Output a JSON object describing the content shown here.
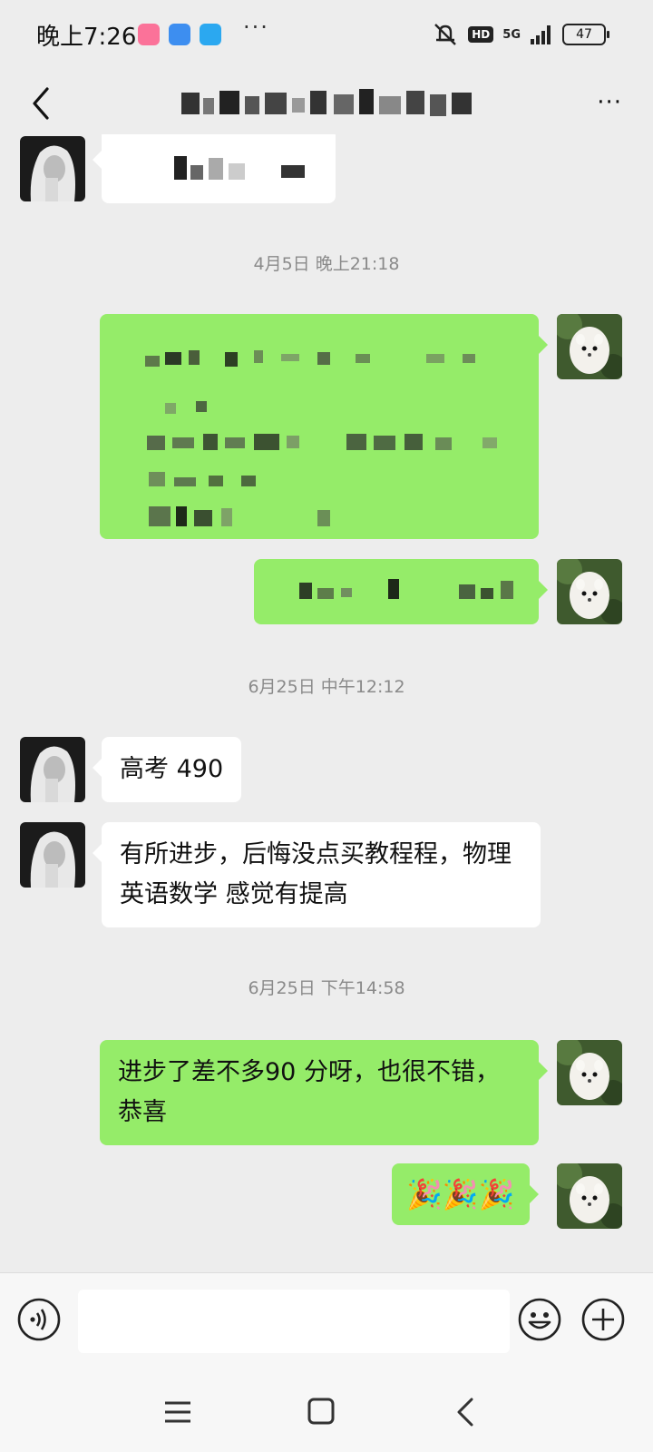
{
  "status_bar": {
    "time": "晚上7:26",
    "app_icons": [
      "bilibili-icon",
      "browser-icon",
      "app-icon"
    ],
    "more": "···",
    "hd": "HD",
    "network": "5G",
    "battery": "47"
  },
  "header": {
    "back_icon": "chevron-left-icon",
    "title_redacted": true,
    "more": "···"
  },
  "messages": [
    {
      "type": "message",
      "side": "left",
      "redacted": true
    },
    {
      "type": "timestamp",
      "text": "4月5日 晚上21:18"
    },
    {
      "type": "message",
      "side": "right",
      "redacted": true
    },
    {
      "type": "message",
      "side": "right",
      "redacted": true
    },
    {
      "type": "timestamp",
      "text": "6月25日 中午12:12"
    },
    {
      "type": "message",
      "side": "left",
      "text": "高考 490"
    },
    {
      "type": "message",
      "side": "left",
      "text": "有所进步，后悔没点买教程程，物理英语数学 感觉有提高"
    },
    {
      "type": "timestamp",
      "text": "6月25日 下午14:58"
    },
    {
      "type": "message",
      "side": "right",
      "text": "进步了差不多90 分呀，也很不错，恭喜"
    },
    {
      "type": "message",
      "side": "right",
      "text": "🎉🎉🎉"
    }
  ],
  "input_bar": {
    "placeholder": "",
    "voice_icon": "voice-icon",
    "emoji_icon": "emoji-icon",
    "plus_icon": "plus-icon"
  },
  "system_nav": [
    "menu-icon",
    "home-icon",
    "back-icon"
  ],
  "colors": {
    "background": "#ededed",
    "bubble_right": "#95ec69",
    "bubble_left": "#ffffff",
    "timestamp": "#8a8a8a"
  }
}
